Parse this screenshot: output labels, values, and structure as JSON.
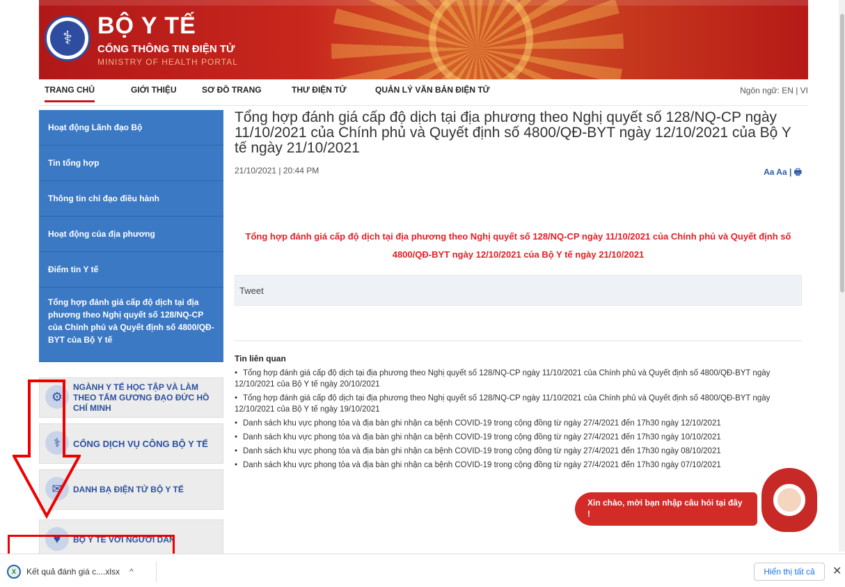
{
  "header": {
    "title": "BỘ Y TẾ",
    "subtitle": "CỔNG THÔNG TIN ĐIỆN TỬ",
    "english": "MINISTRY OF HEALTH PORTAL"
  },
  "nav": {
    "items": [
      "TRANG CHỦ",
      "GIỚI THIỆU",
      "SƠ ĐỒ TRANG",
      "THƯ ĐIỆN TỬ",
      "QUẢN LÝ VĂN BẢN ĐIỆN TỬ"
    ],
    "language": "Ngôn ngữ: EN | VI"
  },
  "sidebar": {
    "items": [
      "Hoạt động Lãnh đạo Bộ",
      "Tin tổng hợp",
      "Thông tin chỉ đạo điều hành",
      "Hoạt động của địa phương",
      "Điểm tin Y tế",
      "Tổng hợp đánh giá cấp độ dịch tại địa phương theo Nghị quyết số 128/NQ-CP của Chính phủ và Quyết định số 4800/QĐ-BYT của Bộ Y tế"
    ],
    "banners": [
      "NGÀNH Y TẾ HỌC TẬP VÀ LÀM THEO TẤM GƯƠNG ĐẠO ĐỨC HỒ CHÍ MINH",
      "CỔNG DỊCH VỤ CÔNG BỘ Y TẾ",
      "DANH BẠ ĐIỆN TỬ BỘ Y TẾ",
      "BỘ Y TẾ VỚI NGƯỜI DÂN"
    ]
  },
  "article": {
    "title": "Tổng hợp đánh giá cấp độ dịch tại địa phương theo Nghị quyết số 128/NQ-CP ngày 11/10/2021 của Chính phủ và Quyết định số 4800/QĐ-BYT ngày 12/10/2021 của Bộ Y tế ngày 21/10/2021",
    "date": "21/10/2021 | 20:44 PM",
    "tools": "Aa Aa |",
    "lead": "Tổng hợp đánh giá cấp độ dịch tại địa phương theo Nghị quyết số 128/NQ-CP ngày 11/10/2021 của Chính phủ và Quyết định số 4800/QĐ-BYT ngày 12/10/2021 của Bộ Y tế ngày 21/10/2021",
    "tweet": "Tweet"
  },
  "related": {
    "heading": "Tin liên quan",
    "items": [
      "Tổng hợp đánh giá cấp độ dịch tại địa phương theo Nghị quyết số 128/NQ-CP ngày 11/10/2021 của Chính phủ và Quyết định số 4800/QĐ-BYT ngày 12/10/2021 của Bộ Y tế ngày 20/10/2021",
      "Tổng hợp đánh giá cấp độ dịch tại địa phương theo Nghị quyết số 128/NQ-CP ngày 11/10/2021 của Chính phủ và Quyết định số 4800/QĐ-BYT ngày 12/10/2021 của Bộ Y tế ngày 19/10/2021",
      "Danh sách khu vực phong tỏa và địa bàn ghi nhận ca bệnh COVID-19 trong cộng đồng từ ngày 27/4/2021 đến 17h30 ngày 12/10/2021",
      "Danh sách khu vực phong tỏa và địa bàn ghi nhận ca bệnh COVID-19 trong cộng đồng từ ngày 27/4/2021 đến 17h30 ngày 10/10/2021",
      "Danh sách khu vực phong tỏa và địa bàn ghi nhận ca bệnh COVID-19 trong cộng đồng từ ngày 27/4/2021 đến 17h30 ngày 08/10/2021",
      "Danh sách khu vực phong tỏa và địa bàn ghi nhận ca bệnh COVID-19 trong cộng đồng từ ngày 27/4/2021 đến 17h30 ngày 07/10/2021"
    ]
  },
  "chat": {
    "message": "Xin chào, mời bạn nhập câu hỏi tại đây !"
  },
  "downloads": {
    "file_name": "Kết quả đánh giá c....xlsx",
    "show_all": "Hiển thị tất cả",
    "file_icon": "excel-icon"
  },
  "colors": {
    "brand_red": "#c4161c",
    "sidebar_blue": "#3b79c5",
    "lead_red": "#e31e24"
  }
}
